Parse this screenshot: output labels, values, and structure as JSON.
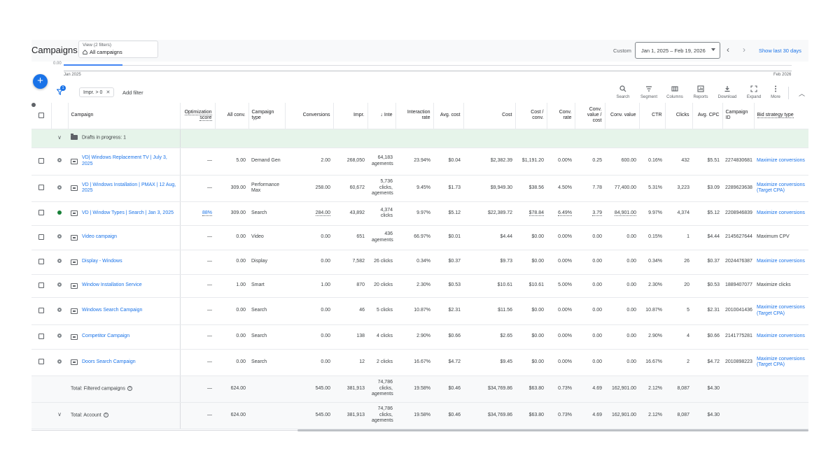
{
  "header": {
    "title": "Campaigns",
    "view_label": "View (2 filters)",
    "view_value": "All campaigns",
    "custom_label": "Custom",
    "date_range": "Jan 1, 2025 – Feb 19, 2026",
    "show_last": "Show last 30 days"
  },
  "chart_strip": {
    "zero": "0.00",
    "start": "Jan 2025",
    "end": "Feb 2026"
  },
  "filter": {
    "badge": "1",
    "chip": "Impr. > 0",
    "add_filter": "Add filter"
  },
  "toolbar": [
    {
      "label": "Search",
      "icon": "search-icon"
    },
    {
      "label": "Segment",
      "icon": "segment-icon"
    },
    {
      "label": "Columns",
      "icon": "columns-icon"
    },
    {
      "label": "Reports",
      "icon": "reports-icon"
    },
    {
      "label": "Download",
      "icon": "download-icon"
    },
    {
      "label": "Expand",
      "icon": "expand-icon"
    },
    {
      "label": "More",
      "icon": "more-icon"
    }
  ],
  "columns": {
    "campaign": "Campaign",
    "opt": "Optimization score",
    "all_conv": "All conv.",
    "type": "Campaign type",
    "conv": "Conversions",
    "impr": "Impr.",
    "inte": "↓ Inte",
    "int_rate": "Interaction rate",
    "avg_cost": "Avg. cost",
    "cost": "Cost",
    "cost_conv": "Cost / conv.",
    "conv_rate": "Conv. rate",
    "cv_cost": "Conv. value / cost",
    "conv_value": "Conv. value",
    "ctr": "CTR",
    "clicks": "Clicks",
    "avg_cpc": "Avg. CPC",
    "id": "Campaign ID",
    "bid": "Bid strategy type"
  },
  "drafts": "Drafts in progress: 1",
  "rows": [
    {
      "name": "VD| Windows Replacement TV | July 3, 2025",
      "status": "paused",
      "opt": "—",
      "all_conv": "5.00",
      "type": "Demand Gen",
      "conv": "2.00",
      "impr": "268,050",
      "inte": "64,183 agements",
      "int_rate": "23.94%",
      "avg_cost": "$0.04",
      "cost": "$2,382.39",
      "cost_conv": "$1,191.20",
      "conv_rate": "0.00%",
      "cv_cost": "0.25",
      "conv_value": "600.00",
      "ctr": "0.16%",
      "clicks": "432",
      "avg_cpc": "$5.51",
      "id": "2274830681",
      "bid": "Maximize conversions"
    },
    {
      "name": "VD | Windows Installation | PMAX | 12 Aug, 2025",
      "status": "paused",
      "opt": "—",
      "all_conv": "309.00",
      "type": "Performance Max",
      "conv": "258.00",
      "impr": "60,672",
      "inte": "5,736 clicks, agements",
      "int_rate": "9.45%",
      "avg_cost": "$1.73",
      "cost": "$9,949.30",
      "cost_conv": "$38.56",
      "conv_rate": "4.50%",
      "cv_cost": "7.78",
      "conv_value": "77,400.00",
      "ctr": "5.31%",
      "clicks": "3,223",
      "avg_cpc": "$3.09",
      "id": "2289623638",
      "bid": "Maximize conversions (Target CPA)"
    },
    {
      "name": "VD | Window Types | Search | Jan 3, 2025",
      "status": "green",
      "opt": "88%",
      "all_conv": "309.00",
      "type": "Search",
      "conv": "284.00",
      "impr": "43,892",
      "inte": "4,374 clicks",
      "int_rate": "9.97%",
      "avg_cost": "$5.12",
      "cost": "$22,389.72",
      "cost_conv": "$78.84",
      "conv_rate": "6.49%",
      "cv_cost": "3.79",
      "conv_value": "84,901.00",
      "ctr": "9.97%",
      "clicks": "4,374",
      "avg_cpc": "$5.12",
      "id": "2208946839",
      "bid": "Maximize conversions"
    },
    {
      "name": "Video campaign",
      "status": "paused",
      "opt": "—",
      "all_conv": "0.00",
      "type": "Video",
      "conv": "0.00",
      "impr": "651",
      "inte": "436 agements",
      "int_rate": "66.97%",
      "avg_cost": "$0.01",
      "cost": "$4.44",
      "cost_conv": "$0.00",
      "conv_rate": "0.00%",
      "cv_cost": "0.00",
      "conv_value": "0.00",
      "ctr": "0.15%",
      "clicks": "1",
      "avg_cpc": "$4.44",
      "id": "2145627644",
      "bid": "Maximum CPV"
    },
    {
      "name": "Display - Windows",
      "status": "paused",
      "opt": "—",
      "all_conv": "0.00",
      "type": "Display",
      "conv": "0.00",
      "impr": "7,582",
      "inte": "26 clicks",
      "int_rate": "0.34%",
      "avg_cost": "$0.37",
      "cost": "$9.73",
      "cost_conv": "$0.00",
      "conv_rate": "0.00%",
      "cv_cost": "0.00",
      "conv_value": "0.00",
      "ctr": "0.34%",
      "clicks": "26",
      "avg_cpc": "$0.37",
      "id": "2024476387",
      "bid": "Maximize conversions"
    },
    {
      "name": "Window Installation Service",
      "status": "paused",
      "opt": "—",
      "all_conv": "1.00",
      "type": "Smart",
      "conv": "1.00",
      "impr": "870",
      "inte": "20 clicks",
      "int_rate": "2.30%",
      "avg_cost": "$0.53",
      "cost": "$10.61",
      "cost_conv": "$10.61",
      "conv_rate": "5.00%",
      "cv_cost": "0.00",
      "conv_value": "0.00",
      "ctr": "2.30%",
      "clicks": "20",
      "avg_cpc": "$0.53",
      "id": "1889407077",
      "bid": "Maximize clicks"
    },
    {
      "name": "Windows Search Campaign",
      "status": "paused",
      "opt": "—",
      "all_conv": "0.00",
      "type": "Search",
      "conv": "0.00",
      "impr": "46",
      "inte": "5 clicks",
      "int_rate": "10.87%",
      "avg_cost": "$2.31",
      "cost": "$11.56",
      "cost_conv": "$0.00",
      "conv_rate": "0.00%",
      "cv_cost": "0.00",
      "conv_value": "0.00",
      "ctr": "10.87%",
      "clicks": "5",
      "avg_cpc": "$2.31",
      "id": "2010041436",
      "bid": "Maximize conversions (Target CPA)"
    },
    {
      "name": "Competitor Campaign",
      "status": "paused",
      "opt": "—",
      "all_conv": "0.00",
      "type": "Search",
      "conv": "0.00",
      "impr": "138",
      "inte": "4 clicks",
      "int_rate": "2.90%",
      "avg_cost": "$0.66",
      "cost": "$2.65",
      "cost_conv": "$0.00",
      "conv_rate": "0.00%",
      "cv_cost": "0.00",
      "conv_value": "0.00",
      "ctr": "2.90%",
      "clicks": "4",
      "avg_cpc": "$0.66",
      "id": "2141775281",
      "bid": "Maximize conversions"
    },
    {
      "name": "Doors Search Campaign",
      "status": "paused",
      "opt": "—",
      "all_conv": "0.00",
      "type": "Search",
      "conv": "0.00",
      "impr": "12",
      "inte": "2 clicks",
      "int_rate": "16.67%",
      "avg_cost": "$4.72",
      "cost": "$9.45",
      "cost_conv": "$0.00",
      "conv_rate": "0.00%",
      "cv_cost": "0.00",
      "conv_value": "0.00",
      "ctr": "16.67%",
      "clicks": "2",
      "avg_cpc": "$4.72",
      "id": "2010898223",
      "bid": "Maximize conversions (Target CPA)"
    }
  ],
  "totals": [
    {
      "label": "Total: Filtered campaigns",
      "opt": "—",
      "all_conv": "624.00",
      "conv": "545.00",
      "impr": "381,913",
      "inte": "74,786 clicks, agements",
      "int_rate": "19.58%",
      "avg_cost": "$0.46",
      "cost": "$34,769.86",
      "cost_conv": "$63.80",
      "conv_rate": "0.73%",
      "cv_cost": "4.69",
      "conv_value": "162,901.00",
      "ctr": "2.12%",
      "clicks": "8,087",
      "avg_cpc": "$4.30"
    },
    {
      "label": "Total: Account",
      "opt": "—",
      "all_conv": "624.00",
      "conv": "545.00",
      "impr": "381,913",
      "inte": "74,786 clicks, agements",
      "int_rate": "19.58%",
      "avg_cost": "$0.46",
      "cost": "$34,769.86",
      "cost_conv": "$63.80",
      "conv_rate": "0.73%",
      "cv_cost": "4.69",
      "conv_value": "162,901.00",
      "ctr": "2.12%",
      "clicks": "8,087",
      "avg_cpc": "$4.30"
    }
  ]
}
